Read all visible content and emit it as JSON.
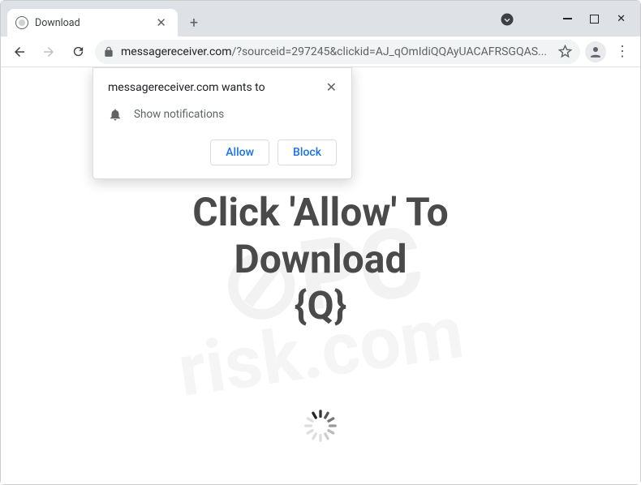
{
  "window": {
    "tab_title": "Download"
  },
  "toolbar": {
    "url_host": "messagereceiver.com",
    "url_path": "/?sourceid=297245&clickid=AJ_qOmIdiQQAyUACAFRSGQAS..."
  },
  "permission": {
    "origin_line": "messagereceiver.com wants to",
    "capability": "Show notifications",
    "allow_label": "Allow",
    "block_label": "Block"
  },
  "page": {
    "headline_line1": "Click 'Allow' To",
    "headline_line2": "Download",
    "headline_line3": "{Q}"
  }
}
